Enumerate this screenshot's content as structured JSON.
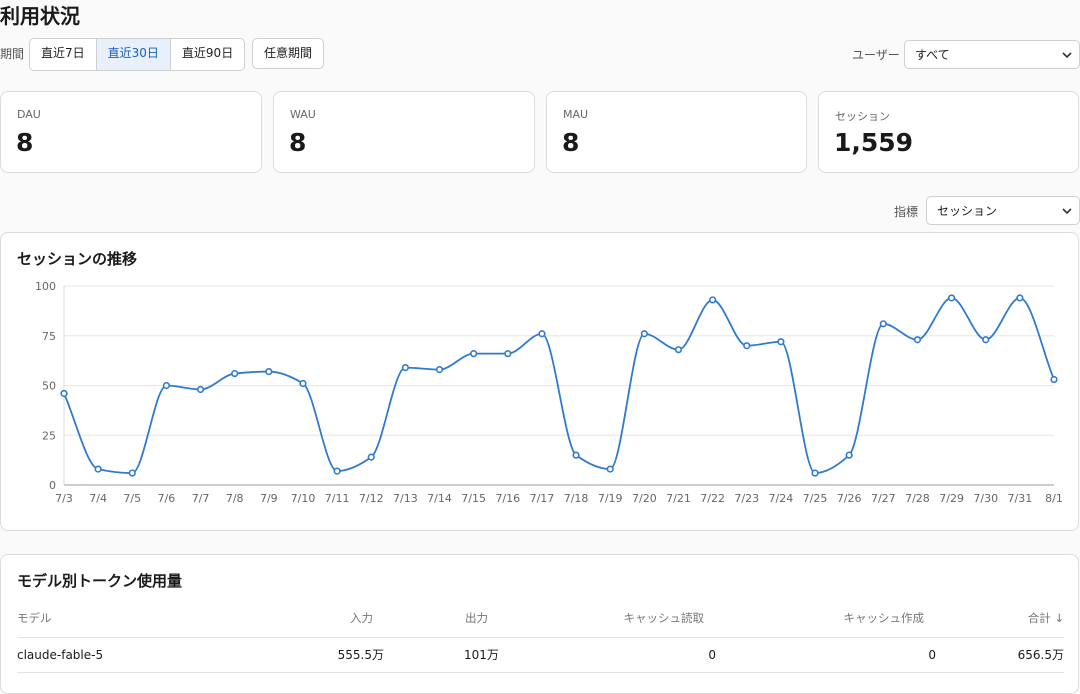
{
  "page": {
    "title": "利用状況"
  },
  "filters": {
    "period_label": "期間",
    "period_options": [
      "直近7日",
      "直近30日",
      "直近90日"
    ],
    "period_active": "直近30日",
    "custom_label": "任意期間",
    "user_label": "ユーザー",
    "user_value": "すべて",
    "metric_label": "指標",
    "metric_value": "セッション"
  },
  "cards": [
    {
      "label": "DAU",
      "value": "8"
    },
    {
      "label": "WAU",
      "value": "8"
    },
    {
      "label": "MAU",
      "value": "8"
    },
    {
      "label": "セッション",
      "value": "1,559"
    }
  ],
  "chart_panel": {
    "title": "セッションの推移"
  },
  "chart_data": {
    "type": "line",
    "title": "セッションの推移",
    "x": [
      "7/3",
      "7/4",
      "7/5",
      "7/6",
      "7/7",
      "7/8",
      "7/9",
      "7/10",
      "7/11",
      "7/12",
      "7/13",
      "7/14",
      "7/15",
      "7/16",
      "7/17",
      "7/18",
      "7/19",
      "7/20",
      "7/21",
      "7/22",
      "7/23",
      "7/24",
      "7/25",
      "7/26",
      "7/27",
      "7/28",
      "7/29",
      "7/30",
      "7/31",
      "8/1"
    ],
    "series": [
      {
        "values": [
          46,
          8,
          6,
          50,
          48,
          56,
          57,
          51,
          7,
          14,
          59,
          58,
          66,
          66,
          76,
          15,
          8,
          76,
          68,
          93,
          70,
          72,
          6,
          15,
          81,
          73,
          94,
          73,
          94,
          53
        ]
      }
    ],
    "yticks": [
      0,
      25,
      50,
      75,
      100
    ],
    "ylim": [
      0,
      100
    ],
    "grid": true,
    "color": "#2f7ad0"
  },
  "table_panel": {
    "title": "モデル別トークン使用量",
    "columns": [
      "モデル",
      "入力",
      "出力",
      "キャッシュ読取",
      "キャッシュ作成",
      "合計 ↓"
    ],
    "rows": [
      [
        "claude-fable-5",
        "555.5万",
        "101万",
        "0",
        "0",
        "656.5万"
      ]
    ]
  }
}
